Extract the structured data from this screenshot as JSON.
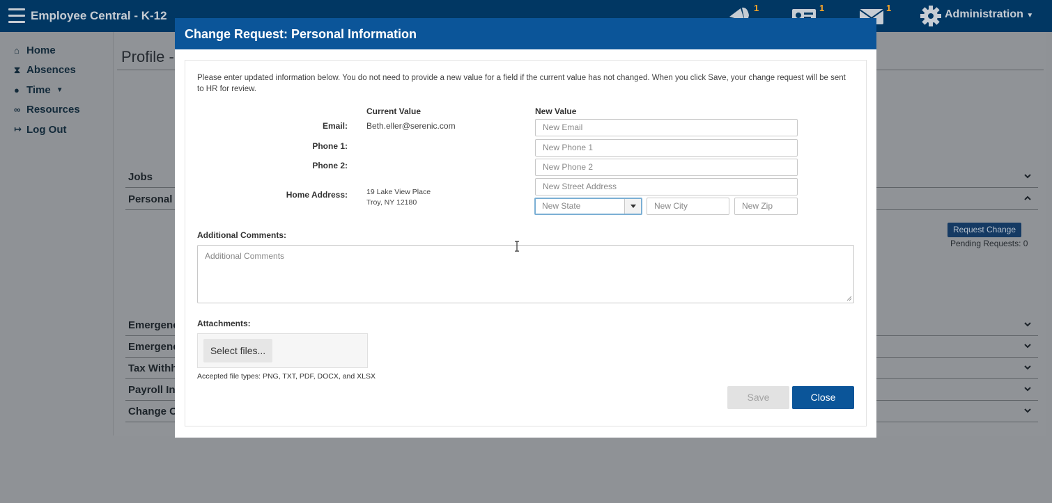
{
  "app": {
    "title": "Employee Central - K-12",
    "badges": {
      "notifications": "1",
      "id_card": "1",
      "messages": "1"
    },
    "admin_label": "Administration"
  },
  "sidebar": {
    "items": [
      {
        "label": "Home",
        "icon": "home-icon"
      },
      {
        "label": "Absences",
        "icon": "hourglass-icon"
      },
      {
        "label": "Time",
        "icon": "clock-icon"
      },
      {
        "label": "Resources",
        "icon": "link-icon"
      },
      {
        "label": "Log Out",
        "icon": "logout-icon"
      }
    ]
  },
  "background": {
    "page_title": "Profile -",
    "sections": [
      "Jobs",
      "Personal I",
      "Emergenc",
      "Emergenc",
      "Tax Withh",
      "Payroll Inf",
      "Change Cr"
    ],
    "request_change_label": "Request Change",
    "pending_requests": "Pending Requests: 0"
  },
  "modal": {
    "title": "Change Request: Personal Information",
    "intro": "Please enter updated information below. You do not need to provide a new value for a field if the current value has not changed. When you click Save, your change request will be sent to HR for review.",
    "current_value_header": "Current Value",
    "new_value_header": "New Value",
    "fields": {
      "email": {
        "label": "Email:",
        "current": "Beth.eller@serenic.com",
        "placeholder": "New Email"
      },
      "phone1": {
        "label": "Phone 1:",
        "current": "",
        "placeholder": "New Phone 1"
      },
      "phone2": {
        "label": "Phone 2:",
        "current": "",
        "placeholder": "New Phone 2"
      },
      "address": {
        "label": "Home Address:",
        "current_line1": "19 Lake View Place",
        "current_line2": "Troy, NY 12180",
        "street_placeholder": "New Street Address",
        "state_placeholder": "New State",
        "city_placeholder": "New City",
        "zip_placeholder": "New Zip"
      }
    },
    "comments_label": "Additional Comments:",
    "comments_placeholder": "Additional Comments",
    "attachments_label": "Attachments:",
    "select_files_label": "Select files...",
    "accepted_types": "Accepted file types: PNG, TXT, PDF, DOCX, and XLSX",
    "save_label": "Save",
    "close_label": "Close"
  },
  "colors": {
    "navbar": "#013763",
    "modal_header": "#0b5599",
    "primary_button": "#0b5599",
    "badge": "#ffa726",
    "overlay": "#8f9296"
  }
}
